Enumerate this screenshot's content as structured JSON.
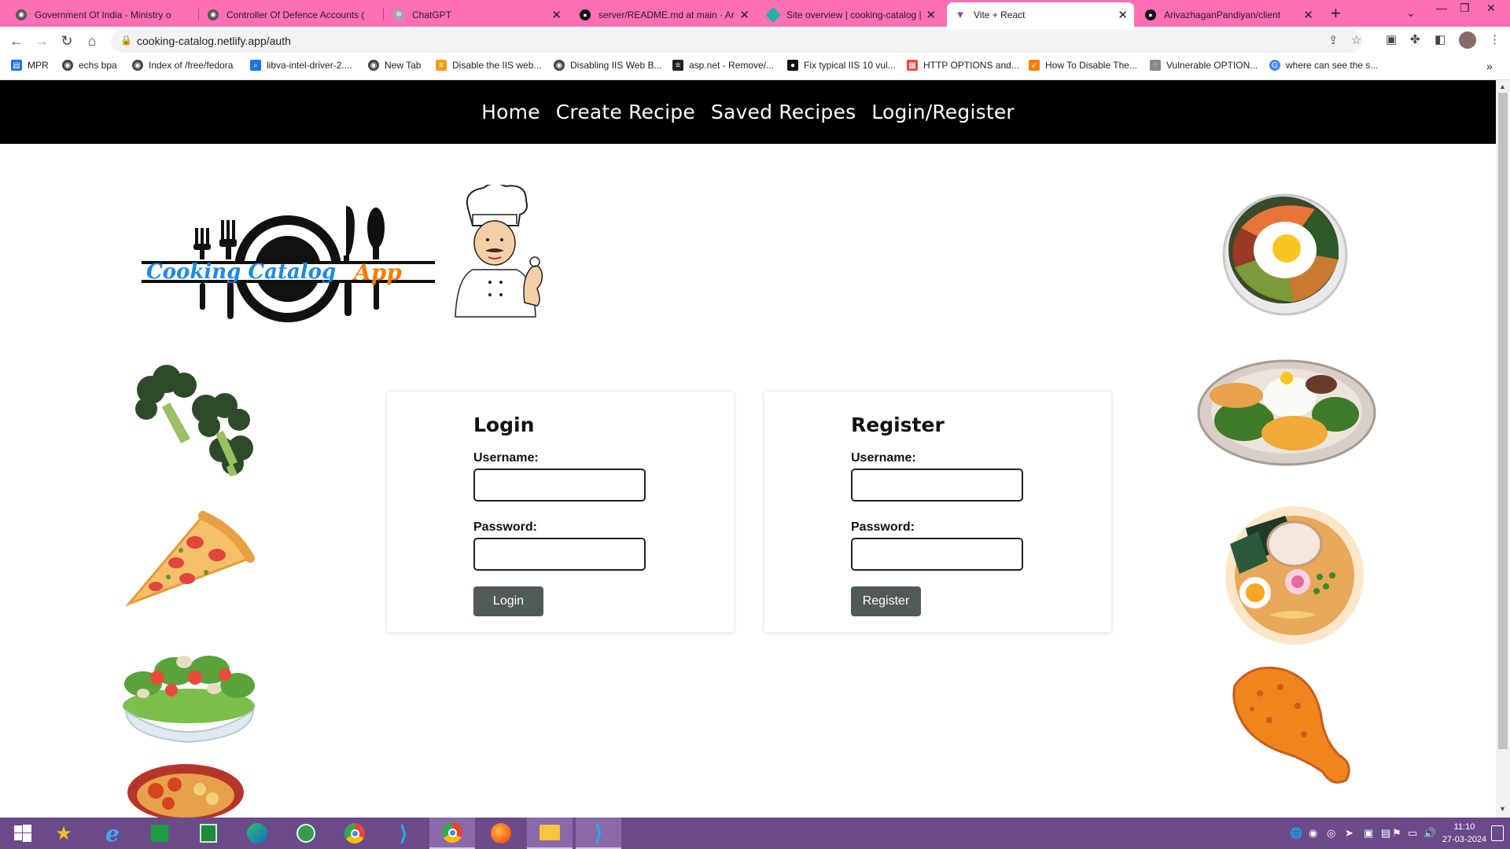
{
  "browser": {
    "tabs": [
      {
        "title": "Government Of India - Ministry o",
        "active": false
      },
      {
        "title": "Controller Of Defence Accounts (",
        "active": false
      },
      {
        "title": "ChatGPT",
        "active": false
      },
      {
        "title": "server/README.md at main · Ari",
        "active": false
      },
      {
        "title": "Site overview | cooking-catalog |",
        "active": false
      },
      {
        "title": "Vite + React",
        "active": true
      },
      {
        "title": "ArivazhaganPandiyan/client",
        "active": false
      }
    ],
    "url": "cooking-catalog.netlify.app/auth",
    "bookmarks": [
      "MPR",
      "echs bpa",
      "Index of /free/fedora",
      "libva-intel-driver-2....",
      "New Tab",
      "Disable the IIS web...",
      "Disabling IIS Web B...",
      "asp.net - Remove/...",
      "Fix typical IIS 10 vul...",
      "HTTP OPTIONS and...",
      "How To Disable The...",
      "Vulnerable OPTION...",
      "where can see the s..."
    ]
  },
  "nav": {
    "home": "Home",
    "create": "Create Recipe",
    "saved": "Saved Recipes",
    "auth": "Login/Register"
  },
  "logo": {
    "text1": "Cooking Catalog",
    "text2": "App"
  },
  "login": {
    "title": "Login",
    "username_label": "Username:",
    "password_label": "Password:",
    "button": "Login"
  },
  "register": {
    "title": "Register",
    "username_label": "Username:",
    "password_label": "Password:",
    "button": "Register"
  },
  "taskbar": {
    "time": "11:10",
    "date": "27-03-2024"
  },
  "colors": {
    "tabbar": "#ff6fb4",
    "navbar": "#000000",
    "button": "#525a55",
    "logo_blue": "#1e88e5",
    "logo_orange": "#f57c00"
  }
}
